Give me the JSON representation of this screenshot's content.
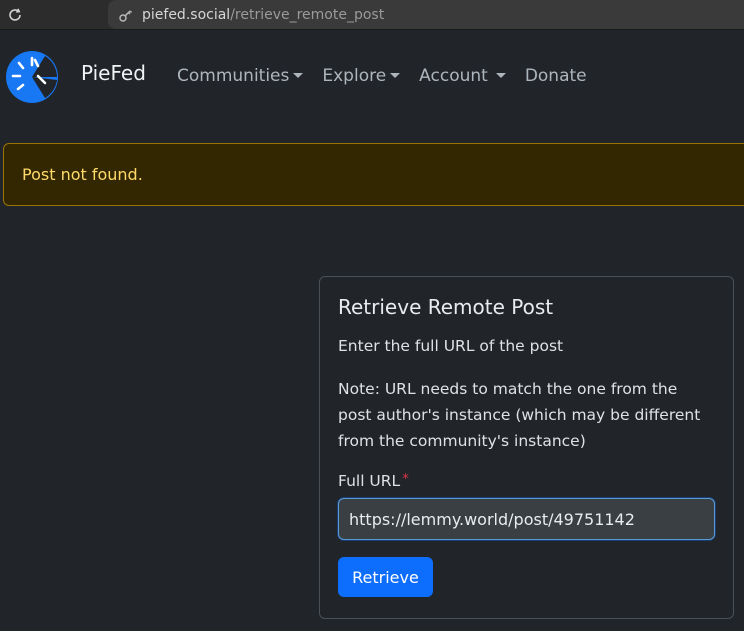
{
  "browser": {
    "url_host": "piefed.social",
    "url_path": "/retrieve_remote_post"
  },
  "navbar": {
    "brand": "PieFed",
    "items": [
      {
        "label": "Communities",
        "dropdown": true
      },
      {
        "label": "Explore",
        "dropdown": true
      },
      {
        "label": "Account",
        "dropdown": true
      },
      {
        "label": "Donate",
        "dropdown": false
      }
    ]
  },
  "alert": {
    "message": "Post not found."
  },
  "card": {
    "title": "Retrieve Remote Post",
    "intro": "Enter the full URL of the post",
    "note": "Note: URL needs to match the one from the post author's instance (which may be different from the community's instance)",
    "field_label": "Full URL",
    "required_marker": "*",
    "field_value": "https://lemmy.world/post/49751142",
    "submit_label": "Retrieve"
  },
  "colors": {
    "background": "#212529",
    "primary": "#0d6efd",
    "alert_bg": "#332701",
    "alert_text": "#ffda6a"
  }
}
